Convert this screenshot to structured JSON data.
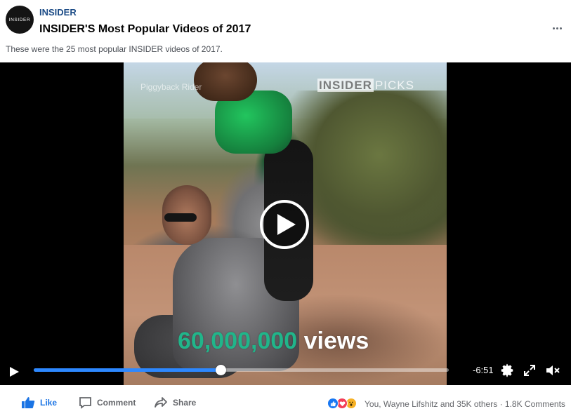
{
  "post": {
    "page_name": "INSIDER",
    "avatar_text": "INSIDER",
    "title": "INSIDER'S Most Popular Videos of 2017",
    "description": "These were the 25 most popular INSIDER videos of 2017."
  },
  "video": {
    "overlay_label": "Piggyback Rider",
    "watermark_brand": "INSIDER",
    "watermark_suffix": "PICKS",
    "views_number": "60,000,000",
    "views_word": "views",
    "time_remaining": "-6:51",
    "progress": 0.45
  },
  "icons": [
    "play-icon",
    "gear-icon",
    "fullscreen-icon",
    "volume-muted-icon",
    "thumbs-up-icon",
    "comment-icon",
    "share-icon",
    "more-icon"
  ],
  "colors": {
    "accent": "#2d88ff",
    "like_blue": "#1b74e4",
    "page_name": "#1b4b86",
    "views_number": "#21b58a"
  },
  "actions": {
    "like": "Like",
    "comment": "Comment",
    "share": "Share",
    "reactions_summary": "You, Wayne Lifshitz and 35K others · 1.8K Comments"
  }
}
